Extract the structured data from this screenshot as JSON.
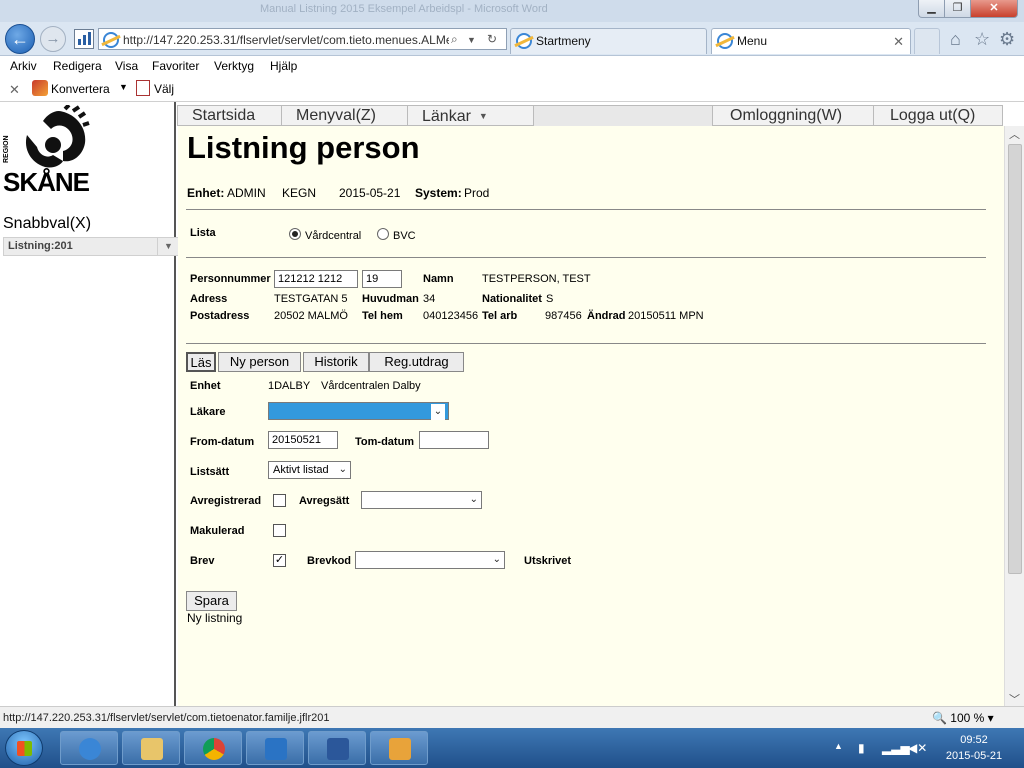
{
  "browser": {
    "window_title": "Manual Listning 2015 Eksempel Arbeidspl - Microsoft Word",
    "url": "http://147.220.253.31/flservlet/servlet/com.tieto.menues.ALMe",
    "tabs": [
      {
        "label": "Startmeny"
      },
      {
        "label": "Menu"
      }
    ],
    "menubar": [
      "Arkiv",
      "Redigera",
      "Visa",
      "Favoriter",
      "Verktyg",
      "Hjälp"
    ],
    "commandbar": {
      "convert_label": "Konvertera",
      "select_label": "Välj"
    }
  },
  "sidebar": {
    "logo_region": "REGION",
    "logo_name": "SKÅNE",
    "snabbval_label": "Snabbval(X)",
    "snabbval_value": "Listning:201"
  },
  "topmenu": {
    "startsida": "Startsida",
    "menyval": "Menyval(Z)",
    "lankar": "Länkar",
    "omloggning": "Omloggning(W)",
    "logga_ut": "Logga ut(Q)"
  },
  "page": {
    "title": "Listning person",
    "enhet_label": "Enhet:",
    "enhet_value": "ADMIN",
    "user": "KEGN",
    "date": "2015-05-21",
    "system_label": "System:",
    "system_value": "Prod"
  },
  "lista": {
    "label": "Lista",
    "options": [
      {
        "label": "Vårdcentral",
        "selected": true
      },
      {
        "label": "BVC",
        "selected": false
      }
    ]
  },
  "person": {
    "personnummer_label": "Personnummer",
    "personnummer_value": "121212 1212",
    "century": "19",
    "namn_label": "Namn",
    "namn_value": "TESTPERSON, TEST",
    "adress_label": "Adress",
    "adress_value": "TESTGATAN 5",
    "huvudman_label": "Huvudman",
    "huvudman_value": "34",
    "nationalitet_label": "Nationalitet",
    "nationalitet_value": "S",
    "postadress_label": "Postadress",
    "postadress_value": "20502  MALMÖ",
    "telhem_label": "Tel hem",
    "telhem_value": "040123456",
    "telarb_label": "Tel arb",
    "telarb_value": "987456",
    "andrad_label": "Ändrad",
    "andrad_value": "20150511 MPN"
  },
  "actions": {
    "las": "Läs",
    "ny_person": "Ny person",
    "historik": "Historik",
    "reg_utdrag": "Reg.utdrag"
  },
  "form": {
    "enhet_label": "Enhet",
    "enhet_code": "1DALBY",
    "enhet_name": "Vårdcentralen Dalby",
    "lakare_label": "Läkare",
    "lakare_value": "",
    "from_label": "From-datum",
    "from_value": "20150521",
    "tom_label": "Tom-datum",
    "tom_value": "",
    "listsatt_label": "Listsätt",
    "listsatt_value": "Aktivt listad",
    "avregistrerad_label": "Avregistrerad",
    "avregsatt_label": "Avregsätt",
    "avregsatt_value": "",
    "makulerad_label": "Makulerad",
    "brev_label": "Brev",
    "brev_checked": true,
    "brev_check_glyph": "✓",
    "brevkod_label": "Brevkod",
    "brevkod_value": "",
    "utskrivet_label": "Utskrivet",
    "spara": "Spara",
    "ny_listning": "Ny listning"
  },
  "statusbar": {
    "url": "http://147.220.253.31/flservlet/servlet/com.tietoenator.familje.jflr201",
    "zoom": "100 %"
  },
  "taskbar": {
    "time": "09:52",
    "date": "2015-05-21"
  },
  "colors": {
    "content_bg": "#ffffee",
    "lakare_highlight": "#3399dd"
  }
}
